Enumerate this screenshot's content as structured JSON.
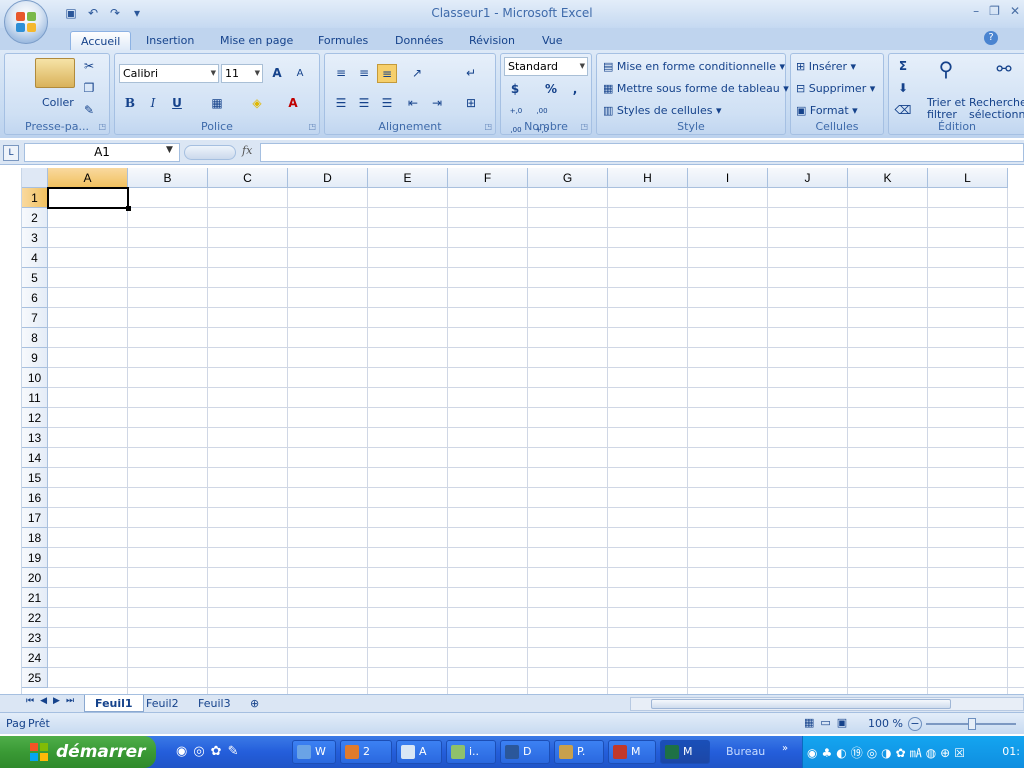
{
  "window": {
    "title": "Classeur1 - Microsoft Excel"
  },
  "qat": {
    "save": "save-icon",
    "undo": "undo-icon",
    "redo": "redo-icon",
    "customize": "▾"
  },
  "tabs": [
    {
      "label": "Accueil",
      "active": true
    },
    {
      "label": "Insertion"
    },
    {
      "label": "Mise en page"
    },
    {
      "label": "Formules"
    },
    {
      "label": "Données"
    },
    {
      "label": "Révision"
    },
    {
      "label": "Vue"
    }
  ],
  "ribbon": {
    "pressepapier": {
      "label": "Presse-pa...",
      "coller": "Coller",
      "cut": "cut-icon",
      "copy": "copy-icon",
      "painter": "format-painter-icon"
    },
    "police": {
      "label": "Police",
      "font": "Calibri",
      "size": "11",
      "bold": "B",
      "italic": "I",
      "underline": "U",
      "grow": "A",
      "shrink": "A"
    },
    "alignement": {
      "label": "Alignement"
    },
    "nombre": {
      "label": "Nombre",
      "format": "Standard",
      "currency": "$",
      "percent": "%",
      "comma": ",",
      "incdec": "+,0 ,00",
      "decdec": ",00 +,0"
    },
    "style": {
      "label": "Style",
      "conditional": "Mise en forme conditionnelle",
      "table": "Mettre sous forme de tableau",
      "cellstyles": "Styles de cellules"
    },
    "cellules": {
      "label": "Cellules",
      "insert": "Insérer",
      "delete": "Supprimer",
      "format": "Format"
    },
    "edition": {
      "label": "Édition",
      "sigma": "Σ",
      "sort": "Trier et",
      "sort2": "filtrer",
      "find": "Rechercher",
      "find2": "sélectionne"
    }
  },
  "formula": {
    "namebox": "A1",
    "fx": "fx",
    "value": ""
  },
  "grid": {
    "columns": [
      "A",
      "B",
      "C",
      "D",
      "E",
      "F",
      "G",
      "H",
      "I",
      "J",
      "K",
      "L"
    ],
    "rows": [
      "1",
      "2",
      "3",
      "4",
      "5",
      "6",
      "7",
      "8",
      "9",
      "10",
      "11",
      "12",
      "13",
      "14",
      "15",
      "16",
      "17",
      "18",
      "19",
      "20",
      "21",
      "22",
      "23",
      "24",
      "25"
    ],
    "active": "A1"
  },
  "sheets": [
    "Feuil1",
    "Feuil2",
    "Feuil3"
  ],
  "status": {
    "left": "Pag",
    "ready": "Prêt",
    "zoom": "100 %"
  },
  "taskbar": {
    "start": "démarrer",
    "items": [
      "W",
      "2",
      "A",
      "i..",
      "D",
      "P.",
      "M",
      "M"
    ],
    "bureau": "Bureau",
    "clock": "01:"
  },
  "colors": {
    "ribbon": "#c7dbf2",
    "selection": "#f1c15f",
    "taskbar": "#245edb",
    "start": "#3a9a35"
  }
}
